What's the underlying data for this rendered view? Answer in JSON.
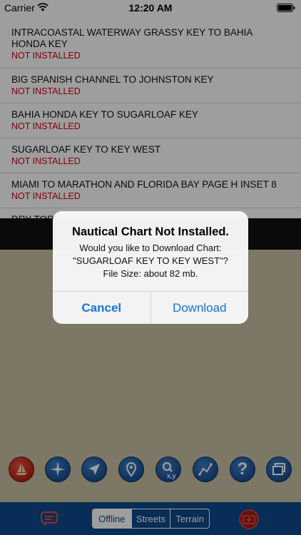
{
  "status_bar": {
    "carrier": "Carrier",
    "time": "12:20 AM"
  },
  "chart_list": [
    {
      "title": "INTRACOASTAL WATERWAY GRASSY KEY TO BAHIA HONDA KEY",
      "status": "NOT INSTALLED"
    },
    {
      "title": "BIG SPANISH CHANNEL TO JOHNSTON KEY",
      "status": "NOT INSTALLED"
    },
    {
      "title": "BAHIA HONDA KEY TO SUGARLOAF KEY",
      "status": "NOT INSTALLED"
    },
    {
      "title": "SUGARLOAF KEY TO KEY WEST",
      "status": "NOT INSTALLED"
    },
    {
      "title": "MIAMI TO MARATHON AND FLORIDA BAY PAGE H INSET 8",
      "status": "NOT INSTALLED"
    },
    {
      "title": "DRY TOR",
      "status": ""
    }
  ],
  "alert": {
    "title": "Nautical Chart Not Installed.",
    "message_line1": "Would you like to Download Chart:",
    "message_line2": "\"SUGARLOAF KEY TO KEY WEST\"?",
    "message_line3": "File Size: about 82 mb.",
    "cancel_label": "Cancel",
    "download_label": "Download"
  },
  "toolbar": {
    "icons": [
      "boat-icon",
      "compass-icon",
      "navigation-arrow-icon",
      "location-pin-icon",
      "coordinates-search-icon",
      "route-icon",
      "help-icon",
      "layers-icon"
    ],
    "coords_label": "x,y",
    "help_label": "?"
  },
  "bottom_bar": {
    "segments": [
      "Offline",
      "Streets",
      "Terrain"
    ],
    "active_segment": "Offline"
  },
  "colors": {
    "accent": "#1a73d9",
    "not_installed": "#d0021b",
    "bottom_bar": "#0d4a8c",
    "map_background": "#c8c2a3"
  }
}
